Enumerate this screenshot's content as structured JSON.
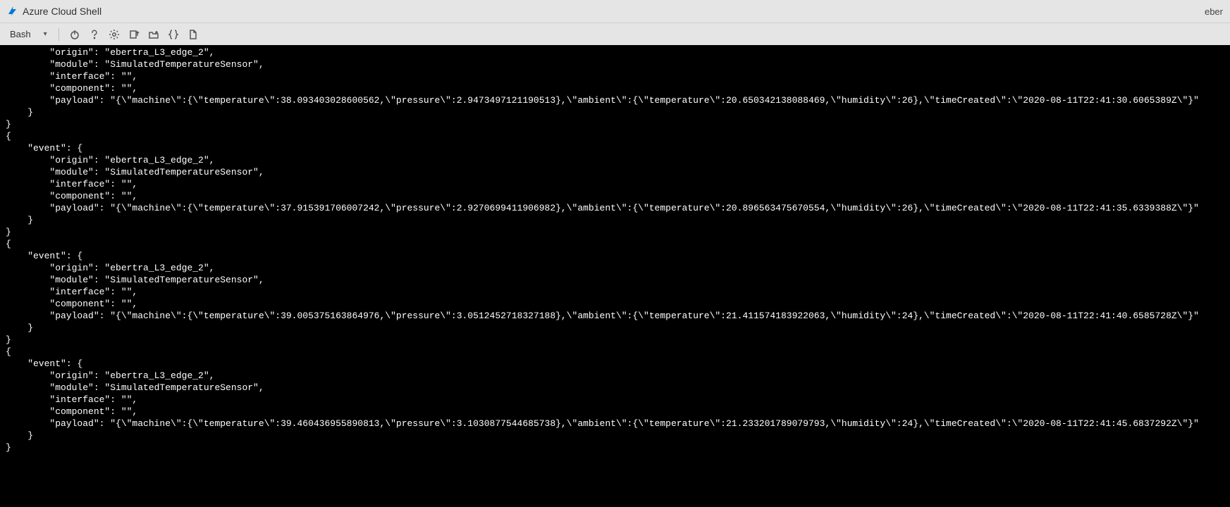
{
  "header": {
    "title": "Azure Cloud Shell",
    "user": "eber"
  },
  "toolbar": {
    "shell": "Bash"
  },
  "events": [
    {
      "origin": "ebertra_L3_edge_2",
      "module": "SimulatedTemperatureSensor",
      "interface": "",
      "component": "",
      "payload": "{\\\"machine\\\":{\\\"temperature\\\":38.093403028600562,\\\"pressure\\\":2.9473497121190513},\\\"ambient\\\":{\\\"temperature\\\":20.650342138088469,\\\"humidity\\\":26},\\\"timeCreated\\\":\\\"2020-08-11T22:41:30.6065389Z\\\"}",
      "first_partial": true
    },
    {
      "origin": "ebertra_L3_edge_2",
      "module": "SimulatedTemperatureSensor",
      "interface": "",
      "component": "",
      "payload": "{\\\"machine\\\":{\\\"temperature\\\":37.915391706007242,\\\"pressure\\\":2.9270699411906982},\\\"ambient\\\":{\\\"temperature\\\":20.896563475670554,\\\"humidity\\\":26},\\\"timeCreated\\\":\\\"2020-08-11T22:41:35.6339388Z\\\"}"
    },
    {
      "origin": "ebertra_L3_edge_2",
      "module": "SimulatedTemperatureSensor",
      "interface": "",
      "component": "",
      "payload": "{\\\"machine\\\":{\\\"temperature\\\":39.005375163864976,\\\"pressure\\\":3.0512452718327188},\\\"ambient\\\":{\\\"temperature\\\":21.411574183922063,\\\"humidity\\\":24},\\\"timeCreated\\\":\\\"2020-08-11T22:41:40.6585728Z\\\"}"
    },
    {
      "origin": "ebertra_L3_edge_2",
      "module": "SimulatedTemperatureSensor",
      "interface": "",
      "component": "",
      "payload": "{\\\"machine\\\":{\\\"temperature\\\":39.460436955890813,\\\"pressure\\\":3.1030877544685738},\\\"ambient\\\":{\\\"temperature\\\":21.233201789079793,\\\"humidity\\\":24},\\\"timeCreated\\\":\\\"2020-08-11T22:41:45.6837292Z\\\"}"
    }
  ]
}
